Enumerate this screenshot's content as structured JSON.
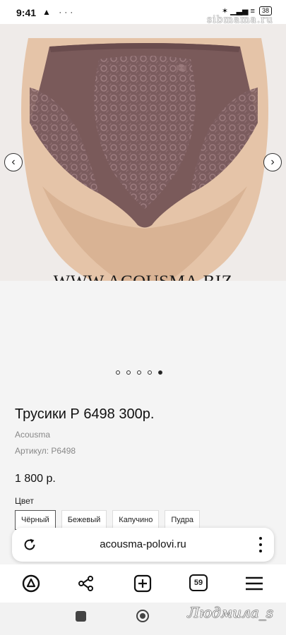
{
  "status_bar": {
    "time": "9:41",
    "left_icons": "▲ ···",
    "signal": "✶ ▁▃▅ ≡",
    "battery": "38"
  },
  "watermarks": {
    "top_right": "sibmama.ru",
    "site": "WWW.ACOUSMA.BIZ",
    "signature": "Людмила_s"
  },
  "carousel": {
    "prev_icon": "chevron-left-icon",
    "next_icon": "chevron-right-icon",
    "dot_count": 5,
    "active_index": 4,
    "left_glyph": "‹",
    "right_glyph": "›"
  },
  "product": {
    "title": "Трусики Р 6498 300р.",
    "brand": "Acousma",
    "sku": "Артикул: Р6498",
    "price": "1 800 р.",
    "color_label": "Цвет",
    "colors": [
      {
        "label": "Чёрный",
        "selected": true
      },
      {
        "label": "Бежевый",
        "selected": false
      },
      {
        "label": "Капучино",
        "selected": false
      },
      {
        "label": "Пудра",
        "selected": false
      }
    ]
  },
  "browser": {
    "url": "acousma-polovi.ru",
    "tabs_count": "59"
  },
  "colors": {
    "garment": "#7a5a5a",
    "lace": "#8a6b6c",
    "skin": "#e8c9ad",
    "background": "#f4f4f4"
  }
}
